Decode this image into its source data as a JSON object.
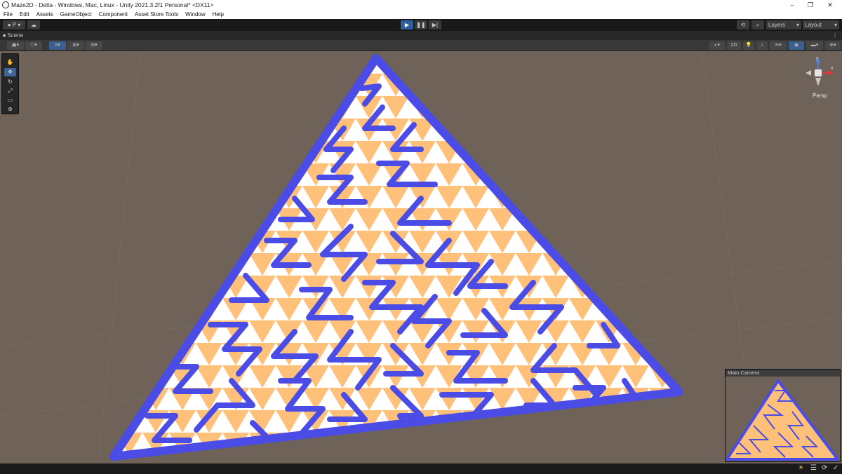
{
  "window": {
    "title": "Maze2D - Delta - Windows, Mac, Linux - Unity 2021.3.2f1 Personal* <DX11>",
    "controls": [
      "–",
      "❐",
      "✕"
    ]
  },
  "menu": [
    "File",
    "Edit",
    "Assets",
    "GameObject",
    "Component",
    "Asset Store Tools",
    "Window",
    "Help"
  ],
  "toolbar": {
    "account_label": "P",
    "layers_label": "Layers",
    "layout_label": "Layout"
  },
  "scene_tab": {
    "label": "Scene"
  },
  "scene_toolbar": {
    "mode_2d_label": "2D"
  },
  "gizmo": {
    "projection_label": "Persp",
    "axis_x": "x",
    "axis_y": "y"
  },
  "camera_preview": {
    "title": "Main Camera"
  },
  "colors": {
    "wall": "#4b4ce6",
    "wall_dark": "#2a2a8e",
    "cell_light": "#ffffff",
    "cell_fill": "#ffc07a",
    "scene_bg": "#6f6359",
    "play_accent": "#3a78c8"
  }
}
